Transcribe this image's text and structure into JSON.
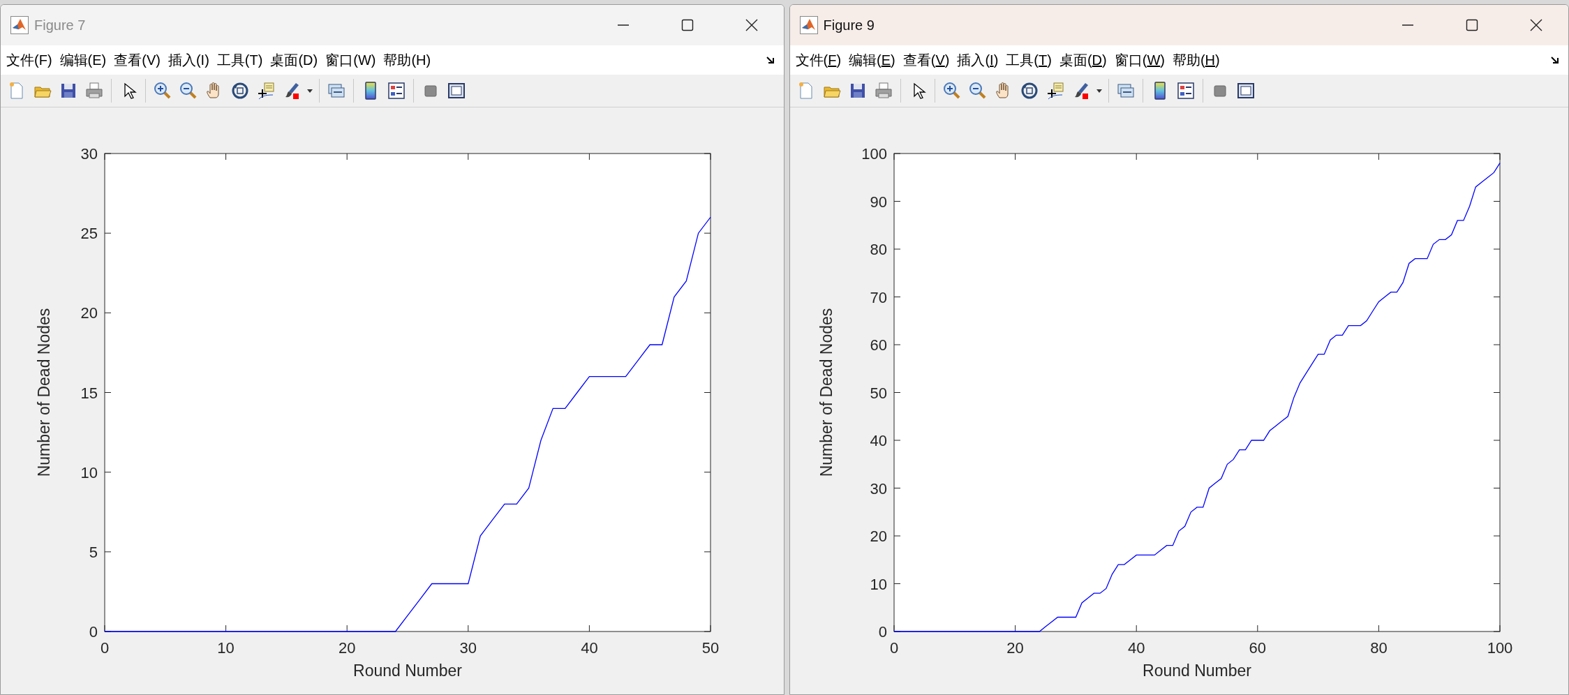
{
  "windows": [
    {
      "title": "Figure 7",
      "active": false,
      "access_keys_underlined": false,
      "menu": [
        "文件(F)",
        "编辑(E)",
        "查看(V)",
        "插入(I)",
        "工具(T)",
        "桌面(D)",
        "窗口(W)",
        "帮助(H)"
      ],
      "chart_data": {
        "type": "line",
        "xlabel": "Round Number",
        "ylabel": "Number of Dead Nodes",
        "xlim": [
          0,
          50
        ],
        "ylim": [
          0,
          30
        ],
        "xticks": [
          0,
          10,
          20,
          30,
          40,
          50
        ],
        "yticks": [
          0,
          5,
          10,
          15,
          20,
          25,
          30
        ],
        "x": [
          0,
          1,
          2,
          3,
          4,
          5,
          6,
          7,
          8,
          9,
          10,
          11,
          12,
          13,
          14,
          15,
          16,
          17,
          18,
          19,
          20,
          21,
          22,
          23,
          24,
          25,
          26,
          27,
          28,
          29,
          30,
          31,
          32,
          33,
          34,
          35,
          36,
          37,
          38,
          39,
          40,
          41,
          42,
          43,
          44,
          45,
          46,
          47,
          48,
          49,
          50
        ],
        "series": [
          {
            "color": "#0000ff",
            "values": [
              0,
              0,
              0,
              0,
              0,
              0,
              0,
              0,
              0,
              0,
              0,
              0,
              0,
              0,
              0,
              0,
              0,
              0,
              0,
              0,
              0,
              0,
              0,
              0,
              0,
              1,
              2,
              3,
              3,
              3,
              3,
              6,
              7,
              8,
              8,
              9,
              12,
              14,
              14,
              15,
              16,
              16,
              16,
              16,
              17,
              18,
              18,
              21,
              22,
              25,
              26
            ]
          }
        ]
      }
    },
    {
      "title": "Figure 9",
      "active": true,
      "access_keys_underlined": true,
      "menu": [
        "文件(F)",
        "编辑(E)",
        "查看(V)",
        "插入(I)",
        "工具(T)",
        "桌面(D)",
        "窗口(W)",
        "帮助(H)"
      ],
      "chart_data": {
        "type": "line",
        "xlabel": "Round Number",
        "ylabel": "Number of Dead Nodes",
        "xlim": [
          0,
          100
        ],
        "ylim": [
          0,
          100
        ],
        "xticks": [
          0,
          20,
          40,
          60,
          80,
          100
        ],
        "yticks": [
          0,
          10,
          20,
          30,
          40,
          50,
          60,
          70,
          80,
          90,
          100
        ],
        "x": [
          0,
          1,
          2,
          3,
          4,
          5,
          6,
          7,
          8,
          9,
          10,
          11,
          12,
          13,
          14,
          15,
          16,
          17,
          18,
          19,
          20,
          21,
          22,
          23,
          24,
          25,
          26,
          27,
          28,
          29,
          30,
          31,
          32,
          33,
          34,
          35,
          36,
          37,
          38,
          39,
          40,
          41,
          42,
          43,
          44,
          45,
          46,
          47,
          48,
          49,
          50,
          51,
          52,
          53,
          54,
          55,
          56,
          57,
          58,
          59,
          60,
          61,
          62,
          63,
          64,
          65,
          66,
          67,
          68,
          69,
          70,
          71,
          72,
          73,
          74,
          75,
          76,
          77,
          78,
          79,
          80,
          81,
          82,
          83,
          84,
          85,
          86,
          87,
          88,
          89,
          90,
          91,
          92,
          93,
          94,
          95,
          96,
          97,
          98,
          99,
          100
        ],
        "series": [
          {
            "color": "#0000ff",
            "values": [
              0,
              0,
              0,
              0,
              0,
              0,
              0,
              0,
              0,
              0,
              0,
              0,
              0,
              0,
              0,
              0,
              0,
              0,
              0,
              0,
              0,
              0,
              0,
              0,
              0,
              1,
              2,
              3,
              3,
              3,
              3,
              6,
              7,
              8,
              8,
              9,
              12,
              14,
              14,
              15,
              16,
              16,
              16,
              16,
              17,
              18,
              18,
              21,
              22,
              25,
              26,
              26,
              30,
              31,
              32,
              35,
              36,
              38,
              38,
              40,
              40,
              40,
              42,
              43,
              44,
              45,
              49,
              52,
              54,
              56,
              58,
              58,
              61,
              62,
              62,
              64,
              64,
              64,
              65,
              67,
              69,
              70,
              71,
              71,
              73,
              77,
              78,
              78,
              78,
              81,
              82,
              82,
              83,
              86,
              86,
              89,
              93,
              94,
              95,
              96,
              98
            ]
          }
        ]
      }
    }
  ]
}
